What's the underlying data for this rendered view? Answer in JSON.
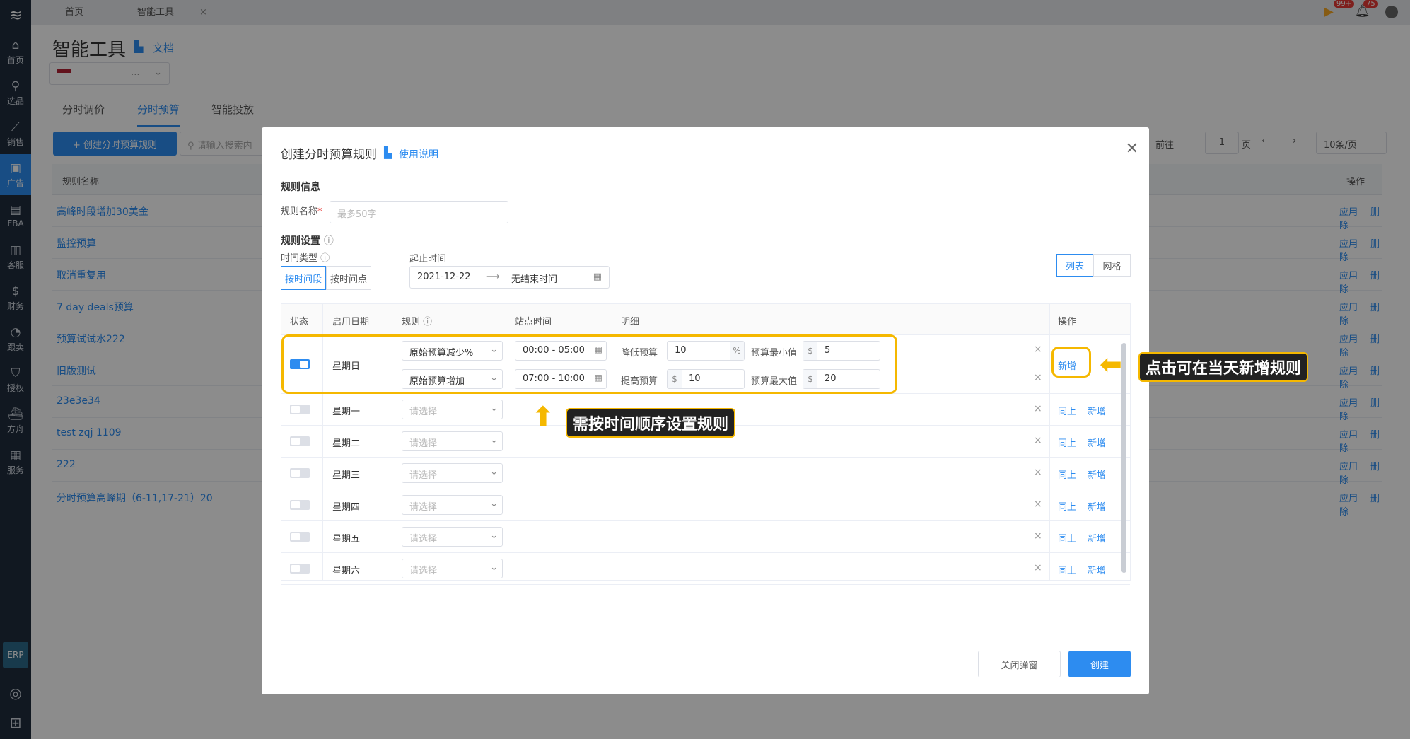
{
  "sidebar": {
    "items": [
      {
        "label": "首页",
        "icon": "home-icon",
        "glyph": "⌂"
      },
      {
        "label": "选品",
        "icon": "search-icon",
        "glyph": "⚲"
      },
      {
        "label": "销售",
        "icon": "chart-icon",
        "glyph": "⟋"
      },
      {
        "label": "广告",
        "icon": "ad-icon",
        "glyph": "▣"
      },
      {
        "label": "FBA",
        "icon": "fba-icon",
        "glyph": "▤"
      },
      {
        "label": "客服",
        "icon": "service-icon",
        "glyph": "▥"
      },
      {
        "label": "财务",
        "icon": "finance-icon",
        "glyph": "$"
      },
      {
        "label": "跟卖",
        "icon": "follow-icon",
        "glyph": "◔"
      },
      {
        "label": "授权",
        "icon": "shield-icon",
        "glyph": "⛉"
      },
      {
        "label": "方舟",
        "icon": "ark-icon",
        "glyph": "⛴"
      },
      {
        "label": "服务",
        "icon": "briefcase-icon",
        "glyph": "▦"
      }
    ],
    "erp": "ERP"
  },
  "topbar": {
    "tabs": [
      "首页",
      "智能工具"
    ],
    "close": "×",
    "badge_msgs": "99+",
    "badge_notify": "75"
  },
  "page": {
    "title": "智能工具",
    "doc_link": "文档",
    "store_select": "...",
    "subtabs": [
      "分时调价",
      "分时预算",
      "智能投放"
    ],
    "create_button": "+ 创建分时预算规则",
    "search_placeholder": "请输入搜索内",
    "pager": {
      "goto": "前往",
      "page": "1",
      "page_unit": "页",
      "page_size": "10条/页"
    },
    "list_header": {
      "name": "规则名称",
      "ops": "操作"
    },
    "rules": [
      "高峰时段增加30美金",
      "监控预算",
      "取消重复用",
      "7 day deals预算",
      "预算试试水222",
      "旧版测试",
      "23e3e34",
      "test zqj 1109",
      "222",
      "分时预算高峰期（6-11,17-21）20"
    ],
    "row_apply": "应用",
    "row_delete": "删除"
  },
  "modal": {
    "title": "创建分时预算规则",
    "help_link": "使用说明",
    "section_info": "规则信息",
    "name_label": "规则名称",
    "name_required": "*",
    "name_placeholder": "最多50字",
    "section_settings": "规则设置",
    "time_type_label": "时间类型",
    "time_type_options": [
      "按时间段",
      "按时间点"
    ],
    "date_range_label": "起止时间",
    "start_date": "2021-12-22",
    "range_sep": "⟶",
    "end_date": "无结束时间",
    "view_options": [
      "列表",
      "网格"
    ],
    "grid_headers": [
      "状态",
      "启用日期",
      "规则",
      "站点时间",
      "明细",
      "操作"
    ],
    "sunday": {
      "day": "星期日",
      "rules": [
        {
          "type": "原始预算减少%",
          "time": "00:00 - 05:00",
          "detail_label": "降低预算",
          "detail_value": "10",
          "detail_unit": "%",
          "limit_label": "预算最小值",
          "limit_unit": "$",
          "limit_value": "5"
        },
        {
          "type": "原始预算增加",
          "time": "07:00 - 10:00",
          "detail_label": "提高预算",
          "detail_unit": "$",
          "detail_value": "10",
          "limit_label": "预算最大值",
          "limit_unit": "$",
          "limit_value": "20"
        }
      ],
      "op_add": "新增"
    },
    "other_days": [
      "星期一",
      "星期二",
      "星期三",
      "星期四",
      "星期五",
      "星期六"
    ],
    "select_placeholder": "请选择",
    "op_same": "同上",
    "op_add": "新增",
    "remove": "×",
    "close_button": "关闭弹窗",
    "create_button": "创建"
  },
  "annotations": {
    "right_callout": "点击可在当天新增规则",
    "bottom_callout": "需按时间顺序设置规则"
  },
  "colors": {
    "accent": "#2d8cf0",
    "highlight": "#f5b800",
    "sidebar": "#1f2d3d"
  }
}
